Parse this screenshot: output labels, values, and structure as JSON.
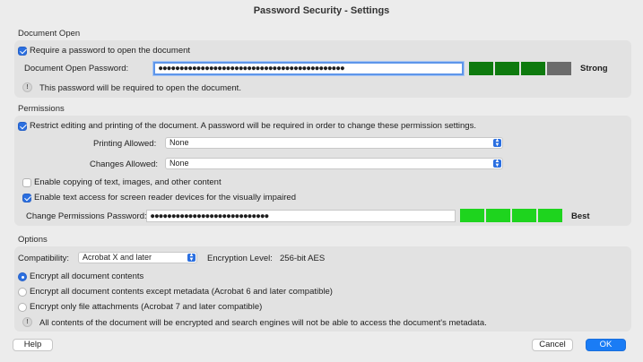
{
  "window": {
    "title": "Password Security - Settings"
  },
  "document_open": {
    "section_title": "Document Open",
    "require_password": {
      "label": "Require a password to open the document",
      "checked": true
    },
    "password_label": "Document Open Password:",
    "password_value": "●●●●●●●●●●●●●●●●●●●●●●●●●●●●●●●●●●●●●●●●●●●●",
    "strength": {
      "label": "Strong",
      "filled": 3,
      "total": 4,
      "color": "#0e7a0e",
      "empty_color": "#6b6b6b"
    },
    "info_text": "This password will be required to open the document."
  },
  "permissions": {
    "section_title": "Permissions",
    "restrict": {
      "label": "Restrict editing and printing of the document. A password will be required in order to change these permission settings.",
      "checked": true
    },
    "printing_label": "Printing Allowed:",
    "printing_value": "None",
    "changes_label": "Changes Allowed:",
    "changes_value": "None",
    "copy": {
      "label": "Enable copying of text, images, and other content",
      "checked": false
    },
    "screen_reader": {
      "label": "Enable text access for screen reader devices for the visually impaired",
      "checked": true
    },
    "password_label": "Change Permissions Password:",
    "password_value": "●●●●●●●●●●●●●●●●●●●●●●●●●●●●",
    "strength": {
      "label": "Best",
      "filled": 4,
      "total": 4,
      "color": "#1ed41e"
    }
  },
  "options": {
    "section_title": "Options",
    "compatibility_label": "Compatibility:",
    "compatibility_value": "Acrobat X and later",
    "encryption_label": "Encryption  Level:",
    "encryption_value": "256-bit AES",
    "radios": [
      {
        "label": "Encrypt all document contents",
        "selected": true
      },
      {
        "label": "Encrypt all document contents except metadata (Acrobat 6 and later compatible)",
        "selected": false
      },
      {
        "label": "Encrypt only file attachments (Acrobat 7 and later compatible)",
        "selected": false
      }
    ],
    "info_text": "All contents of the document will be encrypted and search engines will not be able to access the document's metadata."
  },
  "buttons": {
    "help": "Help",
    "cancel": "Cancel",
    "ok": "OK"
  },
  "icons": {
    "info": "info-icon",
    "arrows": "chevron-up-down-icon"
  }
}
